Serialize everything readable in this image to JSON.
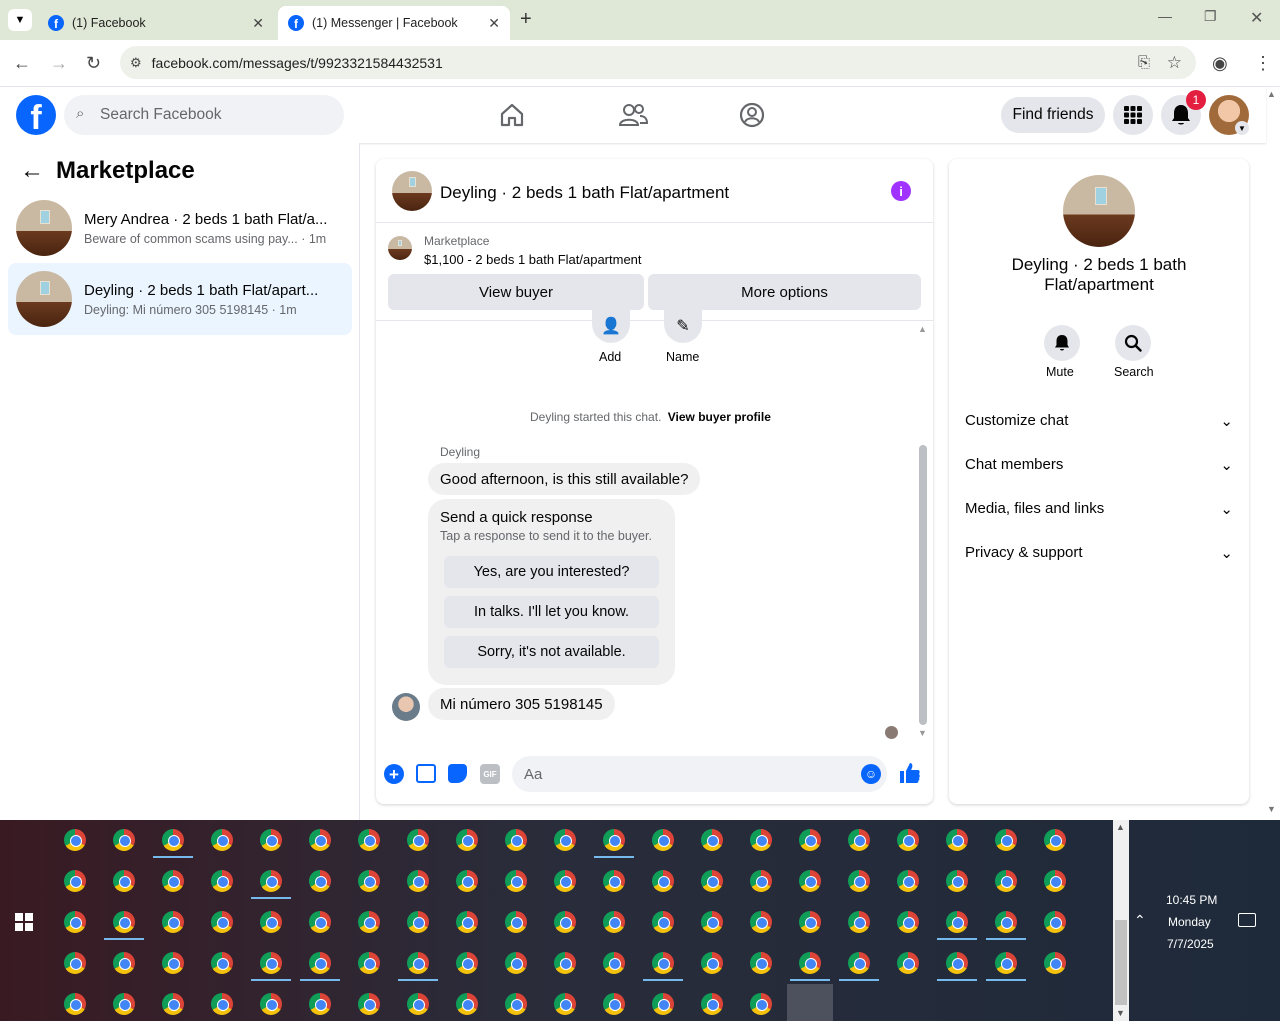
{
  "browser": {
    "tabs": [
      {
        "title": "(1) Facebook"
      },
      {
        "title": "(1) Messenger | Facebook"
      }
    ],
    "url": "facebook.com/messages/t/9923321584432531"
  },
  "fb_header": {
    "logo": "f",
    "search_placeholder": "Search Facebook",
    "find_friends": "Find friends",
    "notification_count": "1"
  },
  "left_panel": {
    "title": "Marketplace",
    "conversations": [
      {
        "title": "Mery Andrea · 2 beds 1 bath Flat/a...",
        "subtitle": "Beware of common scams using pay... · 1m"
      },
      {
        "title": "Deyling · 2 beds 1 bath Flat/apart...",
        "subtitle": "Deyling: Mi número 305 5198145 · 1m"
      }
    ]
  },
  "chat": {
    "title": "Deyling · 2 beds 1 bath Flat/apartment",
    "listing_source": "Marketplace",
    "listing_price": "$1,100 - 2 beds 1 bath Flat/apartment",
    "view_buyer": "View buyer",
    "more_options": "More options",
    "add_label": "Add",
    "name_label": "Name",
    "started_text": "Deyling started this chat.",
    "view_buyer_profile": "View buyer profile",
    "sender_name": "Deyling",
    "message_1": "Good afternoon, is this still available?",
    "quick_response_title": "Send a quick response",
    "quick_response_sub": "Tap a response to send it to the buyer.",
    "quick_responses": [
      "Yes, are you interested?",
      "In talks. I'll let you know.",
      "Sorry, it's not available."
    ],
    "message_2": "Mi número 305 5198145",
    "composer_placeholder": "Aa"
  },
  "right_panel": {
    "title": "Deyling · 2 beds 1 bath Flat/apartment",
    "mute": "Mute",
    "search": "Search",
    "sections": [
      "Customize chat",
      "Chat members",
      "Media, files and links",
      "Privacy & support"
    ]
  },
  "taskbar": {
    "time": "10:45 PM",
    "day": "Monday",
    "date": "7/7/2025"
  },
  "colors": {
    "fb_blue": "#0866ff",
    "messenger_purple": "#a033ff",
    "badge_red": "#e41e3f",
    "selected_row": "#ebf5ff"
  }
}
